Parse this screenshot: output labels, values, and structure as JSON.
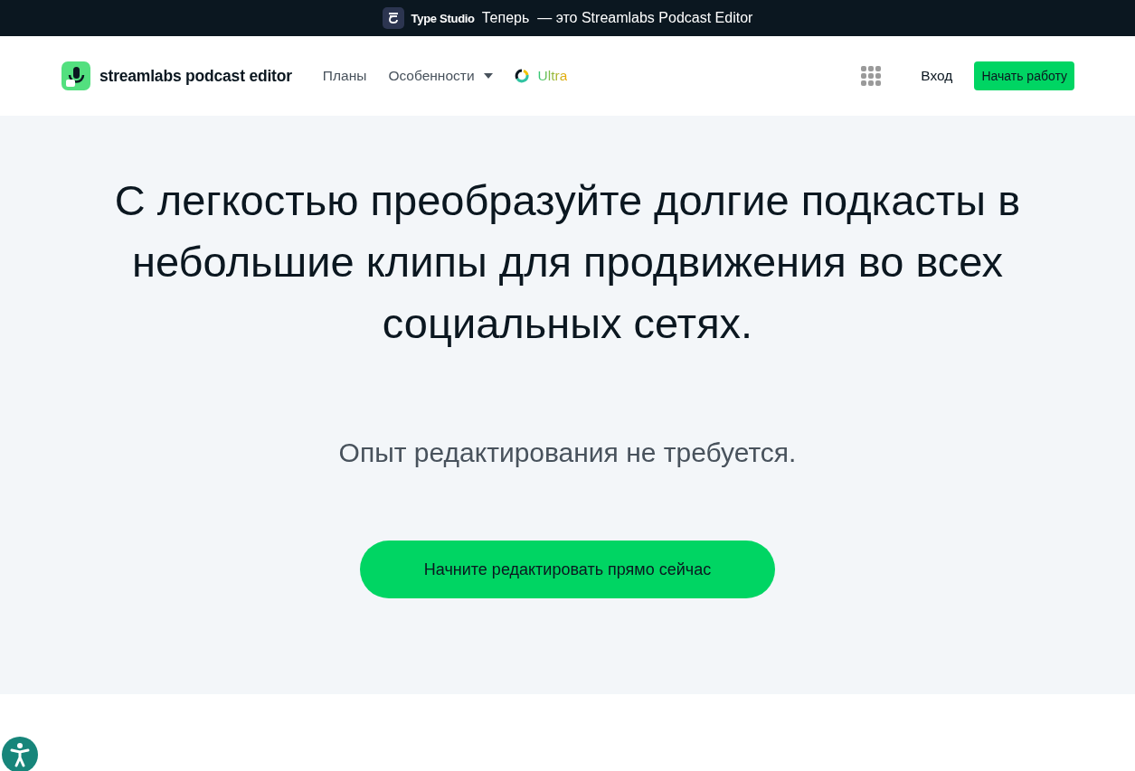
{
  "announcement": {
    "brand": "Type Studio",
    "message": "Теперь  — это Streamlabs Podcast Editor"
  },
  "nav": {
    "logo_text": "streamlabs podcast editor",
    "links": [
      {
        "label": "Планы",
        "kind": "plain"
      },
      {
        "label": "Особенности",
        "kind": "dropdown"
      },
      {
        "label": "Ultra",
        "kind": "ultra"
      }
    ],
    "login": "Вход",
    "cta": "Начать работу"
  },
  "hero": {
    "headline": "С легкостью преобразуйте долгие подкасты в небольшие клипы для продвижения во всех социальных сетях.",
    "subtitle": "Опыт редактирования не требуется.",
    "button": "Начните редактировать прямо сейчас"
  }
}
